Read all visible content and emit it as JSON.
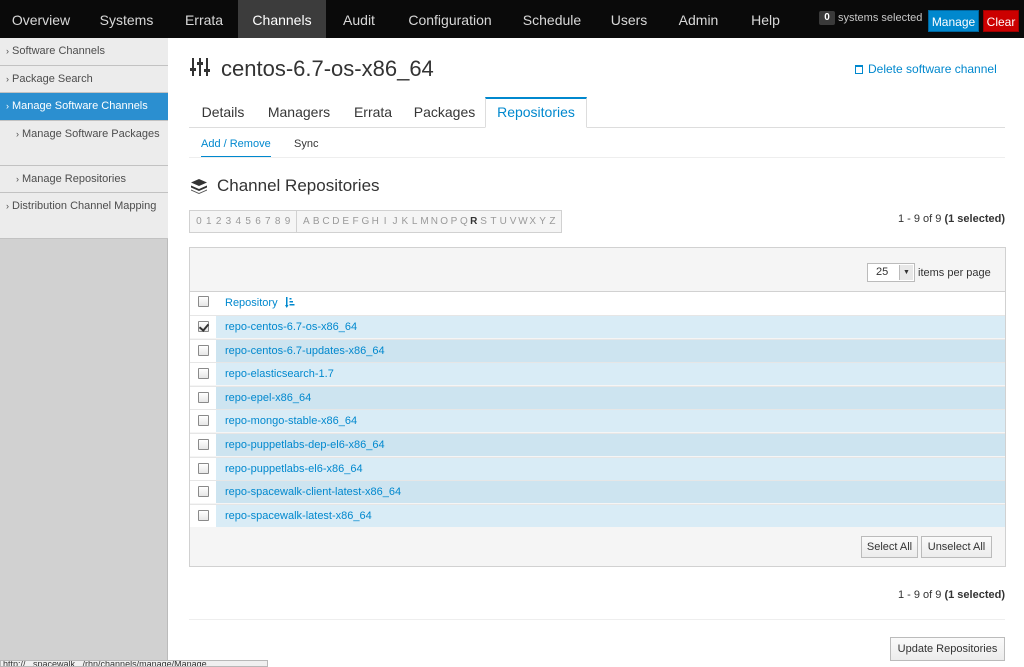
{
  "nav": {
    "items": [
      "Overview",
      "Systems",
      "Errata",
      "Channels",
      "Audit",
      "Configuration",
      "Schedule",
      "Users",
      "Admin",
      "Help"
    ],
    "active": "Channels",
    "systems_count": "0",
    "systems_label": "systems selected",
    "manage_label": "Manage",
    "clear_label": "Clear"
  },
  "sidebar": {
    "items": [
      {
        "label": "Software Channels"
      },
      {
        "label": "Package Search"
      },
      {
        "label": "Manage Software Channels",
        "active": true
      },
      {
        "label": "Manage Software Packages",
        "sub": true
      },
      {
        "label": "Manage Repositories",
        "sub": true
      },
      {
        "label": "Distribution Channel Mapping"
      }
    ]
  },
  "page": {
    "title": "centos-6.7-os-x86_64",
    "delete_label": "Delete software channel"
  },
  "tabs": {
    "items": [
      "Details",
      "Managers",
      "Errata",
      "Packages",
      "Repositories"
    ],
    "active": "Repositories"
  },
  "subtabs": {
    "items": [
      "Add / Remove",
      "Sync"
    ],
    "active": "Add / Remove"
  },
  "section": {
    "title": "Channel Repositories"
  },
  "alphabar": {
    "digits": [
      "0",
      "1",
      "2",
      "3",
      "4",
      "5",
      "6",
      "7",
      "8",
      "9"
    ],
    "letters": [
      "A",
      "B",
      "C",
      "D",
      "E",
      "F",
      "G",
      "H",
      "I",
      "J",
      "K",
      "L",
      "M",
      "N",
      "O",
      "P",
      "Q",
      "R",
      "S",
      "T",
      "U",
      "V",
      "W",
      "X",
      "Y",
      "Z"
    ],
    "enabled": [
      "R"
    ]
  },
  "pagination": {
    "range": "1 - 9 of 9",
    "selected": "(1 selected)"
  },
  "per_page": {
    "value": "25",
    "label": "items per page"
  },
  "table": {
    "column_header": "Repository",
    "rows": [
      {
        "name": "repo-centos-6.7-os-x86_64",
        "checked": true
      },
      {
        "name": "repo-centos-6.7-updates-x86_64",
        "checked": false
      },
      {
        "name": "repo-elasticsearch-1.7",
        "checked": false
      },
      {
        "name": "repo-epel-x86_64",
        "checked": false
      },
      {
        "name": "repo-mongo-stable-x86_64",
        "checked": false
      },
      {
        "name": "repo-puppetlabs-dep-el6-x86_64",
        "checked": false
      },
      {
        "name": "repo-puppetlabs-el6-x86_64",
        "checked": false
      },
      {
        "name": "repo-spacewalk-client-latest-x86_64",
        "checked": false
      },
      {
        "name": "repo-spacewalk-latest-x86_64",
        "checked": false
      }
    ],
    "select_all_label": "Select All",
    "unselect_all_label": "Unselect All"
  },
  "update_label": "Update Repositories",
  "status_url": "http://...spacewalk.../rhn/channels/manage/Manage..."
}
